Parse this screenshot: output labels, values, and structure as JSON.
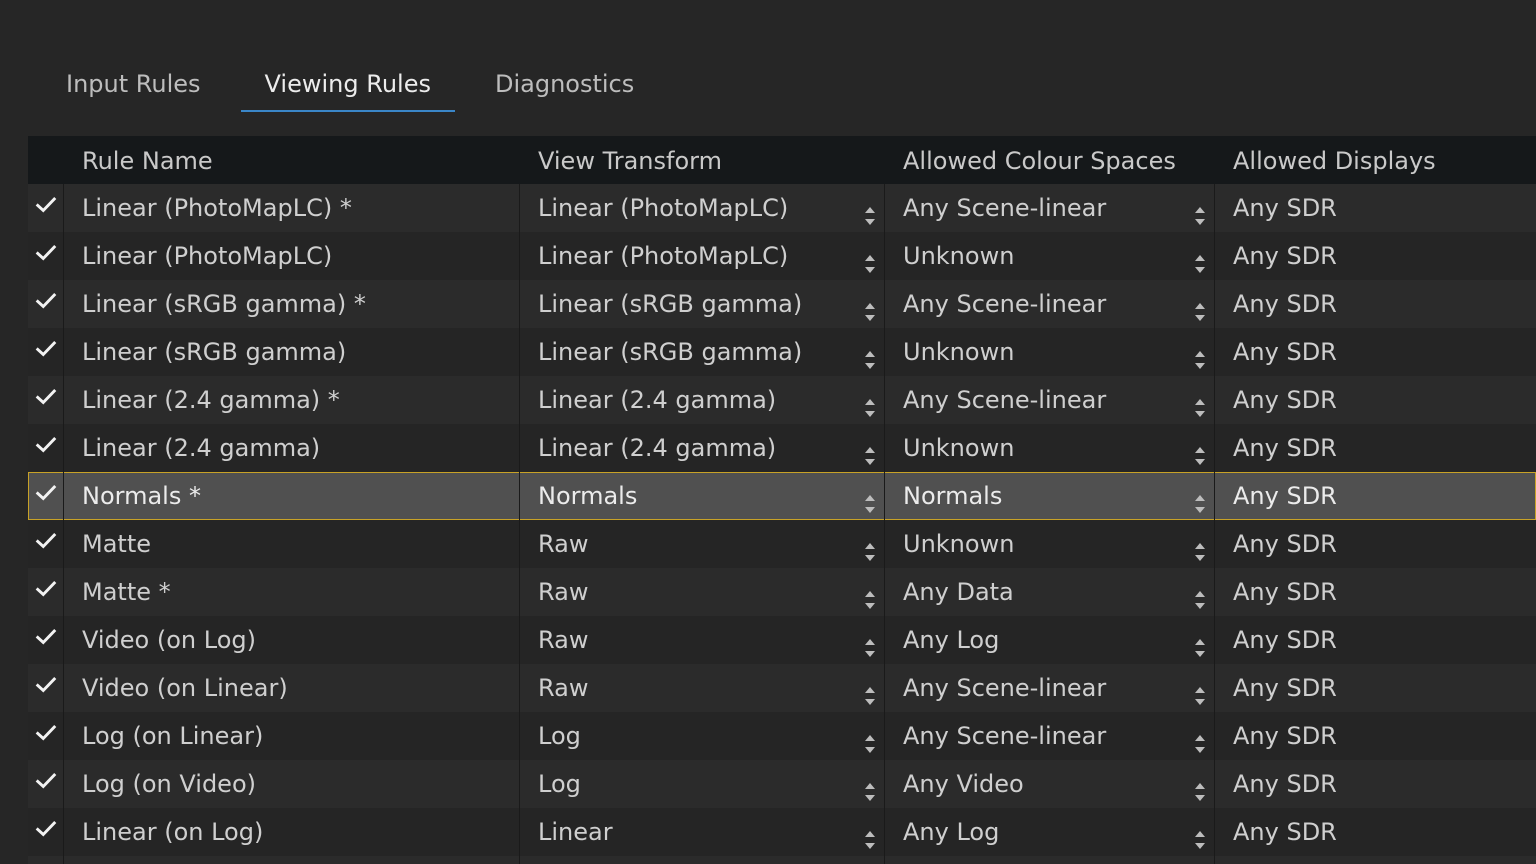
{
  "tabs": [
    {
      "label": "Input Rules",
      "active": false
    },
    {
      "label": "Viewing Rules",
      "active": true
    },
    {
      "label": "Diagnostics",
      "active": false
    }
  ],
  "table": {
    "columns": [
      "Rule Name",
      "View Transform",
      "Allowed Colour Spaces",
      "Allowed Displays"
    ],
    "rows": [
      {
        "enabled": true,
        "name": "Linear (PhotoMapLC) *",
        "view": "Linear (PhotoMapLC)",
        "colour": "Any Scene-linear",
        "display": "Any SDR"
      },
      {
        "enabled": true,
        "name": "Linear (PhotoMapLC)",
        "view": "Linear (PhotoMapLC)",
        "colour": "Unknown",
        "display": "Any SDR"
      },
      {
        "enabled": true,
        "name": "Linear (sRGB gamma) *",
        "view": "Linear (sRGB gamma)",
        "colour": "Any Scene-linear",
        "display": "Any SDR"
      },
      {
        "enabled": true,
        "name": "Linear (sRGB gamma)",
        "view": "Linear (sRGB gamma)",
        "colour": "Unknown",
        "display": "Any SDR"
      },
      {
        "enabled": true,
        "name": "Linear (2.4 gamma) *",
        "view": "Linear (2.4 gamma)",
        "colour": "Any Scene-linear",
        "display": "Any SDR"
      },
      {
        "enabled": true,
        "name": "Linear (2.4 gamma)",
        "view": "Linear (2.4 gamma)",
        "colour": "Unknown",
        "display": "Any SDR"
      },
      {
        "enabled": true,
        "name": "Normals *",
        "view": "Normals",
        "colour": "Normals",
        "display": "Any SDR",
        "selected": true
      },
      {
        "enabled": true,
        "name": "Matte",
        "view": "Raw",
        "colour": "Unknown",
        "display": "Any SDR"
      },
      {
        "enabled": true,
        "name": "Matte *",
        "view": "Raw",
        "colour": "Any Data",
        "display": "Any SDR"
      },
      {
        "enabled": true,
        "name": "Video (on Log)",
        "view": "Raw",
        "colour": "Any Log",
        "display": "Any SDR"
      },
      {
        "enabled": true,
        "name": "Video (on Linear)",
        "view": "Raw",
        "colour": "Any Scene-linear",
        "display": "Any SDR"
      },
      {
        "enabled": true,
        "name": "Log (on Linear)",
        "view": "Log",
        "colour": "Any Scene-linear",
        "display": "Any SDR"
      },
      {
        "enabled": true,
        "name": "Log (on Video)",
        "view": "Log",
        "colour": "Any Video",
        "display": "Any SDR"
      },
      {
        "enabled": true,
        "name": "Linear (on Log)",
        "view": "Linear",
        "colour": "Any Log",
        "display": "Any SDR"
      },
      {
        "enabled": true,
        "name": "",
        "view": "",
        "colour": "",
        "display": ""
      }
    ]
  },
  "colors": {
    "accent": "#3a86c8",
    "selection_outline": "#c8a227"
  },
  "icons": {
    "check": "check-icon",
    "spinner": "up-down-spinner-icon"
  }
}
